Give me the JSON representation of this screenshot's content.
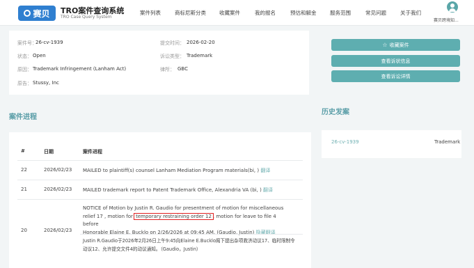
{
  "header": {
    "logo_text": "赛贝",
    "app_title": "TRO案件查询系统",
    "app_subtitle": "TRO Case Query System",
    "nav": [
      {
        "label": "案件列表"
      },
      {
        "label": "商标尼斯分类"
      },
      {
        "label": "收藏案件"
      },
      {
        "label": "我的报名"
      },
      {
        "label": "预估和解金"
      },
      {
        "label": "服务范围"
      },
      {
        "label": "常见问题"
      },
      {
        "label": "关于我们"
      }
    ],
    "user_name": "赛贝跨境知..."
  },
  "case_info": {
    "case_no_label": "案件号：",
    "case_no": "26-cv-1939",
    "filed_label": "提交时间：",
    "filed": "2026-02-20",
    "status_label": "状态：",
    "status": "Open",
    "type_label": "诉讼类型：",
    "type": "Trademark",
    "cause_label": "原因：",
    "cause": "Trademark Infringement (Lanham Act)",
    "lawyer_label": "律所：",
    "lawyer": "GBC",
    "plaintiff_label": "原告：",
    "plaintiff": "Stussy, Inc"
  },
  "actions": {
    "favorite": "收藏案件",
    "complaint": "查看诉状信息",
    "details": "查看诉讼详情"
  },
  "progress": {
    "title": "案件进程",
    "col_no": "#",
    "col_date": "日期",
    "col_entry": "案件进程",
    "rows": [
      {
        "no": "22",
        "date": "2026/02/23",
        "text": "MAILED to plaintiff(s) counsel Lanham Mediation Program materials(bi, )",
        "link": "翻译"
      },
      {
        "no": "21",
        "date": "2026/02/23",
        "text": "MAILED trademark report to Patent Trademark Office, Alexandria VA (bi, )",
        "link": "翻译"
      },
      {
        "no": "20",
        "date": "2026/02/23",
        "line1": "NOTICE of Motion by Justin R. Gaudio for presentment of motion for miscellaneous",
        "line2_pre": "relief 17 , motion for",
        "highlight": "temporary restraining order 12",
        "line2_post": ", motion for leave to file 4 before",
        "line3": "Honorable Elaine E. Bucklo on 2/26/2026 at 09:45 AM. (Gaudio, Justin)",
        "hide_link": "隐藏翻译",
        "translation": "Justin R.Gaudio于2026年2月26日上午9:45向Elaine E.Bucklo阁下提出杂项救济动议17、临时限制令动议12、允许提交文件4的动议通知。（Gaudio，Justin）"
      }
    ]
  },
  "history": {
    "title": "历史发案",
    "items": [
      {
        "case_no": "26-cv-1939",
        "type": "Trademark"
      }
    ]
  }
}
